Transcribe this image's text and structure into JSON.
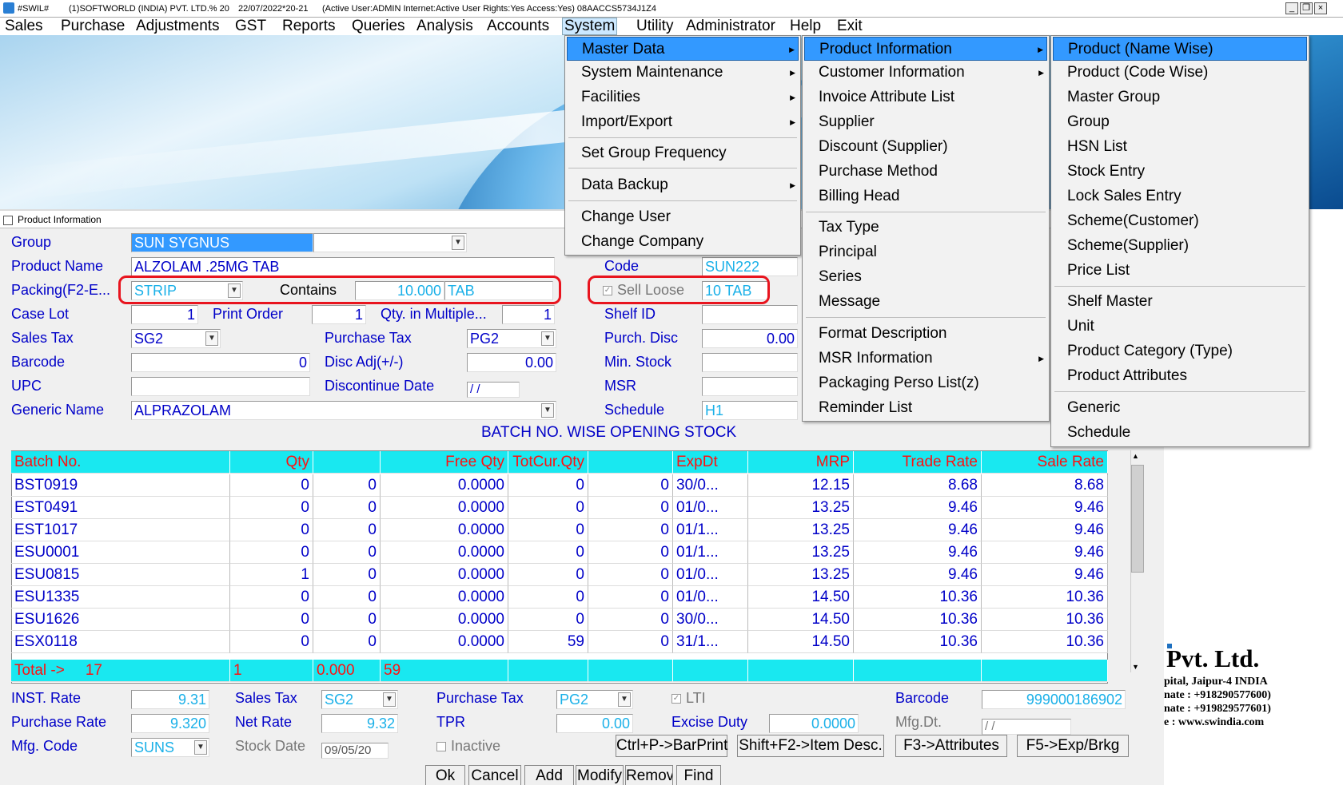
{
  "titlebar": {
    "app": "#SWIL#",
    "company": "(1)SOFTWORLD (INDIA) PVT. LTD.% 20",
    "date": "22/07/2022*20-21",
    "user": "(Active User:ADMIN Internet:Active  User Rights:Yes Access:Yes) 08AACCS5734J1Z4",
    "min": "_",
    "restore": "❐",
    "close": "×"
  },
  "menubar": [
    "Sales",
    "Purchase",
    "Adjustments",
    "GST",
    "Reports",
    "Queries",
    "Analysis",
    "Accounts",
    "System",
    "Utility",
    "Administrator",
    "Help",
    "Exit"
  ],
  "panel_title": "Product Information",
  "form": {
    "group_label": "Group",
    "group_value": "SUN SYGNUS",
    "product_name_label": "Product Name",
    "product_name_value": "ALZOLAM .25MG TAB",
    "code_label": "Code",
    "code_value": "SUN222",
    "packing_label": "Packing(F2-E...",
    "packing_value": "STRIP",
    "contains_label": "Contains",
    "contains_value": "10.000",
    "contains_unit": "TAB",
    "sell_loose_label": "Sell Loose",
    "sell_loose_value": "10 TAB",
    "case_lot_label": "Case Lot",
    "case_lot_value": "1",
    "print_order_label": "Print Order",
    "print_order_value": "1",
    "qty_multiple_label": "Qty. in Multiple...",
    "qty_multiple_value": "1",
    "shelf_id_label": "Shelf ID",
    "shelf_id_value": "",
    "sales_tax_label": "Sales Tax",
    "sales_tax_value": "SG2",
    "purchase_tax_label": "Purchase Tax",
    "purchase_tax_value": "PG2",
    "purch_disc_label": "Purch. Disc",
    "purch_disc_value": "0.00",
    "barcode_label": "Barcode",
    "barcode_value": "0",
    "disc_adj_label": "Disc Adj(+/-)",
    "disc_adj_value": "0.00",
    "min_stock_label": "Min. Stock",
    "min_stock_value": "",
    "upc_label": "UPC",
    "upc_value": "",
    "discontinue_label": "Discontinue Date",
    "discontinue_value": " /  /",
    "msr_label": "MSR",
    "msr_value": "",
    "generic_label": "Generic Name",
    "generic_value": "ALPRAZOLAM",
    "schedule_label": "Schedule",
    "schedule_value": "H1"
  },
  "grid": {
    "title": "BATCH NO. WISE OPENING STOCK",
    "headers": [
      "Batch No.",
      "Qty",
      "",
      "Free Qty",
      "TotCur.Qty",
      "",
      "ExpDt",
      "MRP",
      "Trade Rate",
      "Sale Rate"
    ],
    "rows": [
      [
        "BST0919",
        "0",
        "0",
        "0.0000",
        "0",
        "0",
        "30/0...",
        "12.15",
        "8.68",
        "8.68"
      ],
      [
        "EST0491",
        "0",
        "0",
        "0.0000",
        "0",
        "0",
        "01/0...",
        "13.25",
        "9.46",
        "9.46"
      ],
      [
        "EST1017",
        "0",
        "0",
        "0.0000",
        "0",
        "0",
        "01/1...",
        "13.25",
        "9.46",
        "9.46"
      ],
      [
        "ESU0001",
        "0",
        "0",
        "0.0000",
        "0",
        "0",
        "01/1...",
        "13.25",
        "9.46",
        "9.46"
      ],
      [
        "ESU0815",
        "1",
        "0",
        "0.0000",
        "0",
        "0",
        "01/0...",
        "13.25",
        "9.46",
        "9.46"
      ],
      [
        "ESU1335",
        "0",
        "0",
        "0.0000",
        "0",
        "0",
        "01/0...",
        "14.50",
        "10.36",
        "10.36"
      ],
      [
        "ESU1626",
        "0",
        "0",
        "0.0000",
        "0",
        "0",
        "30/0...",
        "14.50",
        "10.36",
        "10.36"
      ],
      [
        "ESX0118",
        "0",
        "0",
        "0.0000",
        "59",
        "0",
        "31/1...",
        "14.50",
        "10.36",
        "10.36"
      ]
    ],
    "total": {
      "label": "Total ->",
      "count": "17",
      "qty": "1",
      "free": "0.000",
      "totcur": "59"
    }
  },
  "bottom": {
    "inst_rate_label": "INST. Rate",
    "inst_rate_value": "9.31",
    "sales_tax_label": "Sales Tax",
    "sales_tax_value": "SG2",
    "purchase_tax_label": "Purchase Tax",
    "purchase_tax_value": "PG2",
    "lti_label": "LTI",
    "barcode_label": "Barcode",
    "barcode_value": "999000186902",
    "purchase_rate_label": "Purchase Rate",
    "purchase_rate_value": "9.320",
    "net_rate_label": "Net Rate",
    "net_rate_value": "9.32",
    "tpr_label": "TPR",
    "tpr_value": "0.00",
    "excise_label": "Excise Duty",
    "excise_value": "0.0000",
    "mfg_dt_label": "Mfg.Dt.",
    "mfg_dt_value": " /  /",
    "mfg_code_label": "Mfg. Code",
    "mfg_code_value": "SUNS",
    "stock_date_label": "Stock Date",
    "stock_date_value": "09/05/20",
    "inactive_label": "Inactive",
    "btn_barprint": "Ctrl+P->BarPrint",
    "btn_itemdesc": "Shift+F2->Item Desc.",
    "btn_attributes": "F3->Attributes",
    "btn_exp": "F5->Exp/Brkg"
  },
  "actions": [
    "Ok",
    "Cancel",
    "Add",
    "Modify",
    "Remove",
    "Find"
  ],
  "menu_system": [
    "Master Data",
    "System Maintenance",
    "Facilities",
    "Import/Export",
    "Set Group Frequency",
    "Data Backup",
    "Change User",
    "Change Company"
  ],
  "menu_master": [
    "Product Information",
    "Customer Information",
    "Invoice Attribute List",
    "Supplier",
    "Discount (Supplier)",
    "Purchase Method",
    "Billing Head",
    "Tax Type",
    "Principal",
    "Series",
    "Message",
    "Format Description",
    "MSR Information",
    "Packaging Perso List(z)",
    "Reminder List"
  ],
  "menu_product": [
    "Product (Name Wise)",
    "Product (Code Wise)",
    "Master Group",
    "Group",
    "HSN List",
    "Stock Entry",
    "Lock Sales Entry",
    "Scheme(Customer)",
    "Scheme(Supplier)",
    "Price List",
    "Shelf Master",
    "Unit",
    "Product Category (Type)",
    "Product Attributes",
    "Generic",
    "Schedule"
  ],
  "brand": {
    "name": "Pvt. Ltd.",
    "line1": "pital, Jaipur-4 INDIA",
    "line2": "nate : +918290577600)",
    "line3": "nate : +919829577601)",
    "line4": "e : www.swindia.com"
  },
  "colors": {
    "label": "#0000c8",
    "grid_header": "#19e8f0",
    "highlight": "#3399ff",
    "annotation": "#e8141e"
  }
}
